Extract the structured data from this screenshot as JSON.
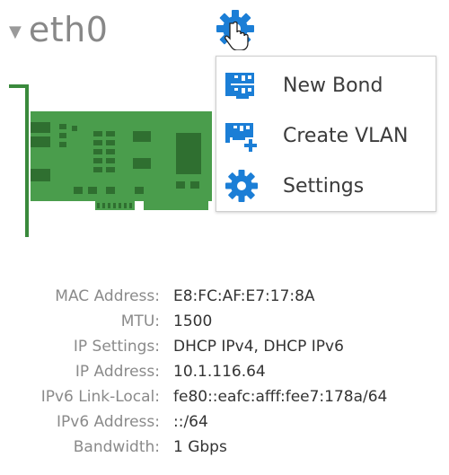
{
  "header": {
    "title": "eth0",
    "expand_icon": "caret-down-icon",
    "settings_icon": "gear-icon"
  },
  "menu": {
    "items": [
      {
        "label": "New Bond",
        "icon": "bond-icon"
      },
      {
        "label": "Create VLAN",
        "icon": "vlan-icon"
      },
      {
        "label": "Settings",
        "icon": "gear-icon"
      }
    ]
  },
  "details": [
    {
      "label": "MAC Address:",
      "value": "E8:FC:AF:E7:17:8A"
    },
    {
      "label": "MTU:",
      "value": "1500"
    },
    {
      "label": "IP Settings:",
      "value": "DHCP IPv4, DHCP IPv6"
    },
    {
      "label": "IP Address:",
      "value": "10.1.116.64"
    },
    {
      "label": "IPv6 Link-Local:",
      "value": "fe80::eafc:afff:fee7:178a/64"
    },
    {
      "label": "IPv6 Address:",
      "value": "::/64"
    },
    {
      "label": "Bandwidth:",
      "value": "1 Gbps"
    }
  ],
  "colors": {
    "accent": "#1b7ed6",
    "nic_green": "#4a9d4c",
    "label_gray": "#8a8a8a",
    "value_dark": "#333333"
  }
}
